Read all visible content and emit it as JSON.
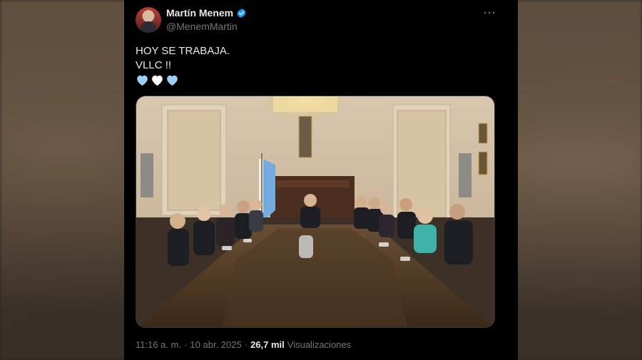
{
  "author": {
    "name": "Martín Menem",
    "handle": "@MenemMartin"
  },
  "post": {
    "line1": "HOY SE TRABAJA.",
    "line2": "VLLC !!",
    "hearts": [
      "blue-heart",
      "white-heart",
      "blue-heart"
    ]
  },
  "meta": {
    "time": "11:16 a. m.",
    "separator1": "·",
    "date": "10 abr. 2025",
    "separator2": "·",
    "views_count": "26,7 mil",
    "views_label": "Visualizaciones"
  },
  "colors": {
    "verified": "#1d9bf0",
    "blue_heart": "#9dd0f5",
    "white_heart": "#ffffff"
  }
}
